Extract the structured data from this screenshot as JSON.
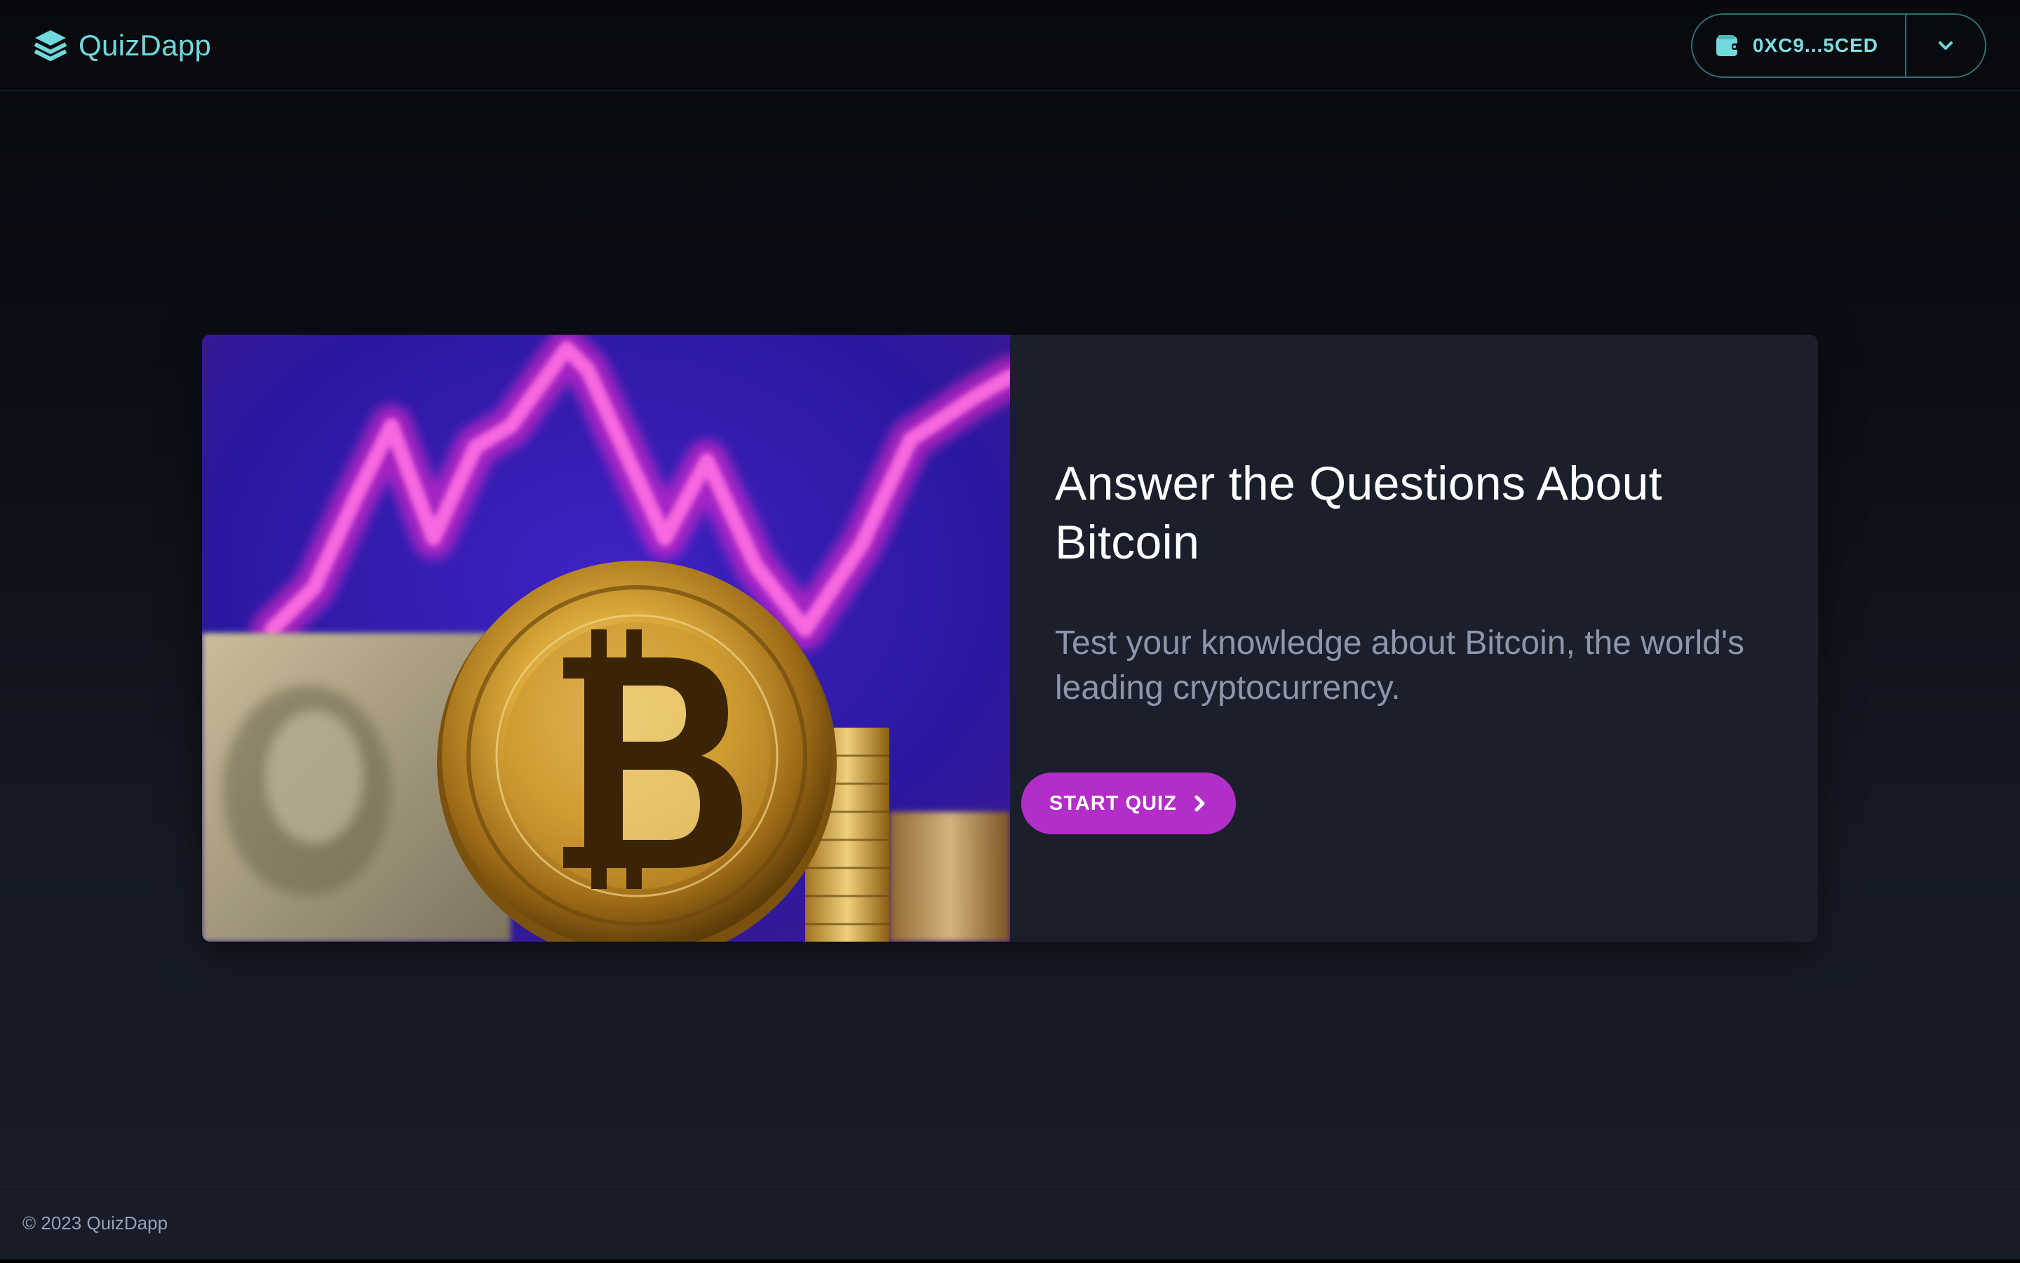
{
  "header": {
    "brand_name": "QuizDapp",
    "logo_icon": "layers-icon",
    "wallet": {
      "icon": "wallet-icon",
      "address": "0XC9...5CED",
      "dropdown_icon": "chevron-down-icon"
    }
  },
  "hero": {
    "image": "bitcoin-coin-chart-image",
    "title": "Answer the Questions About Bitcoin",
    "subtitle": "Test your knowledge about Bitcoin, the world's leading cryptocurrency.",
    "start_button": {
      "label": "START QUIZ",
      "icon": "chevron-right-icon"
    }
  },
  "footer": {
    "copyright": "© 2023 QuizDapp"
  },
  "colors": {
    "accent": "#6fd9dc",
    "button": "#b32ec8",
    "card_bg": "#1b1f2b",
    "page_bg": "#07090d"
  }
}
